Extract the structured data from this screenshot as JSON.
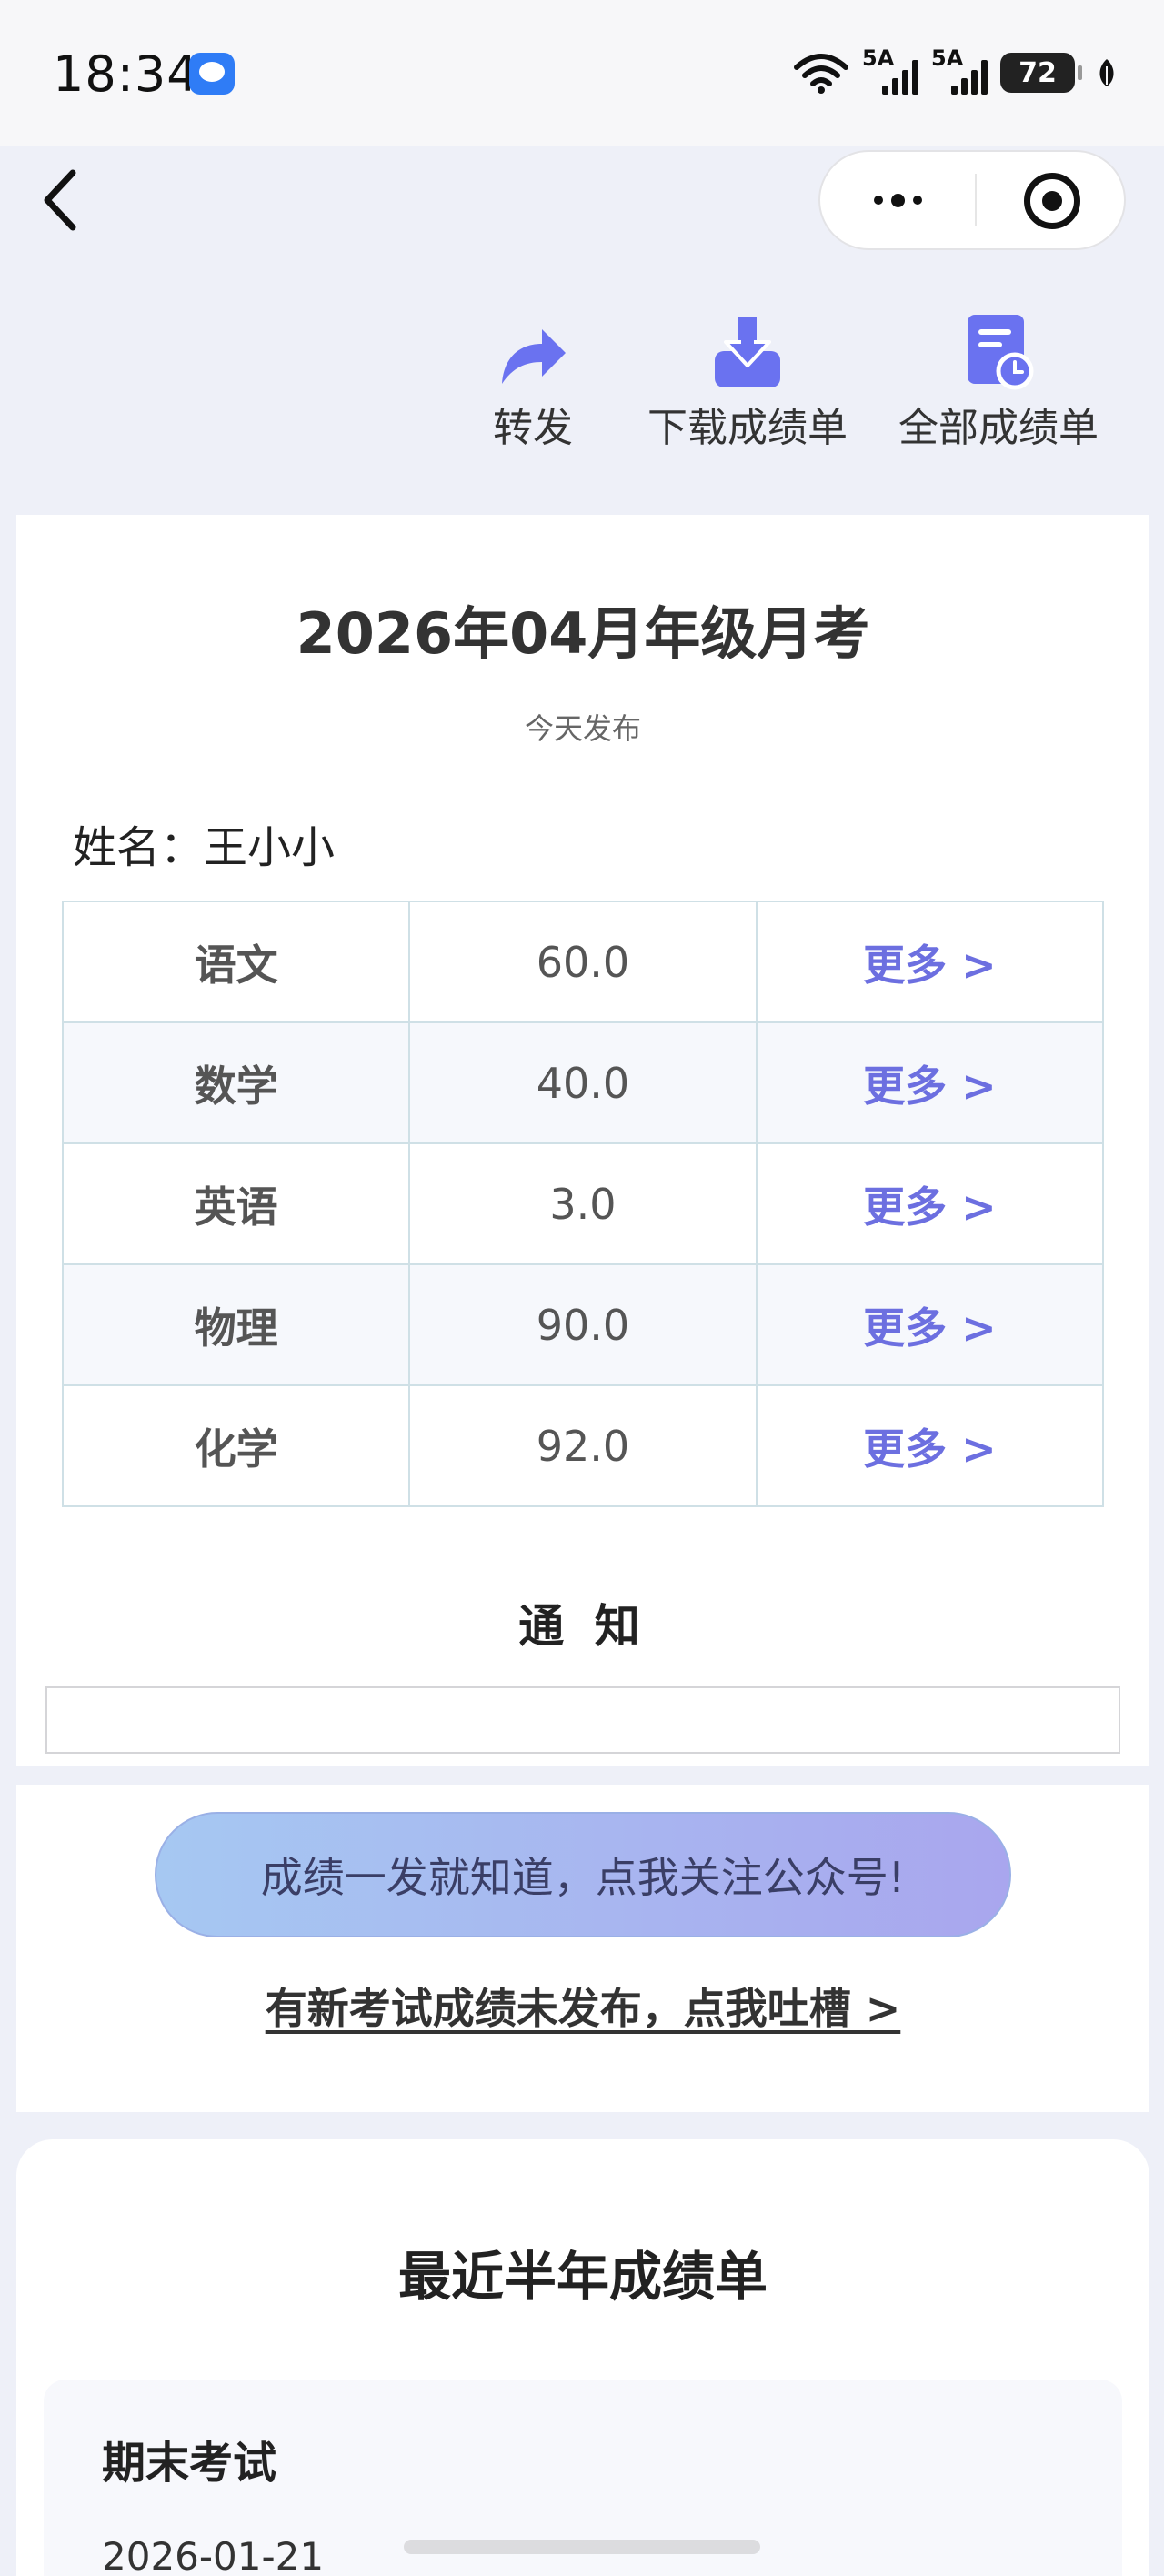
{
  "status_bar": {
    "time": "18:34",
    "network_1": "5A",
    "network_2": "5A",
    "battery": "72"
  },
  "toolbar": {
    "forward_label": "转发",
    "download_label": "下载成绩单",
    "all_reports_label": "全部成绩单"
  },
  "exam": {
    "title": "2026年04月年级月考",
    "published": "今天发布",
    "student_name_line": "姓名：王小小"
  },
  "scores": [
    {
      "subject": "语文",
      "score": "60.0",
      "more": "更多 >"
    },
    {
      "subject": "数学",
      "score": "40.0",
      "more": "更多 >"
    },
    {
      "subject": "英语",
      "score": "3.0",
      "more": "更多 >"
    },
    {
      "subject": "物理",
      "score": "90.0",
      "more": "更多 >"
    },
    {
      "subject": "化学",
      "score": "92.0",
      "more": "更多 >"
    }
  ],
  "notice": {
    "title": "通 知"
  },
  "follow": {
    "button_label": "成绩一发就知道，点我关注公众号!",
    "feedback_link": "有新考试成绩未发布，点我吐槽 >"
  },
  "recent": {
    "title": "最近半年成绩单",
    "items": [
      {
        "name": "期末考试",
        "date": "2026-01-21"
      }
    ]
  },
  "colors": {
    "accent": "#6c6fe0",
    "icon": "#6a72f0",
    "page_bg": "#eef0f8"
  }
}
